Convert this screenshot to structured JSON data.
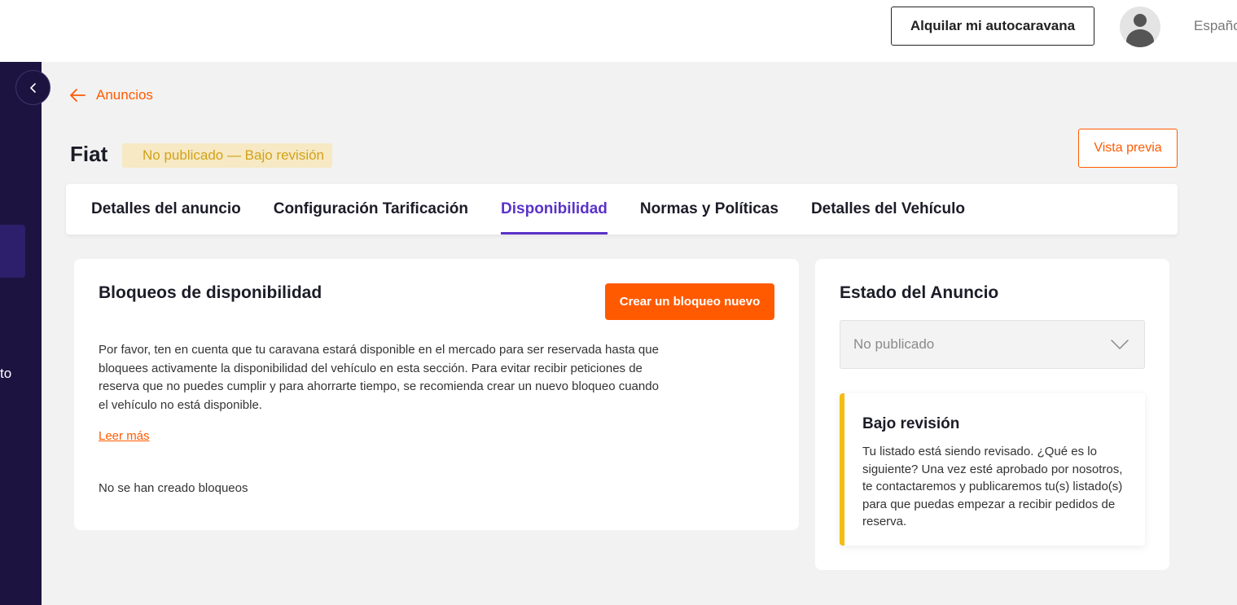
{
  "header": {
    "rent_button": "Alquilar mi autocaravana",
    "language": "Españo"
  },
  "sidebar": {
    "partial_text": "to"
  },
  "back_link": {
    "label": "Anuncios"
  },
  "listing": {
    "title": "Fiat",
    "status_badge": "No publicado — Bajo revisión",
    "preview_button": "Vista previa"
  },
  "tabs": [
    {
      "label": "Detalles del anuncio",
      "active": false
    },
    {
      "label": "Configuración Tarificación",
      "active": false
    },
    {
      "label": "Disponibilidad",
      "active": true
    },
    {
      "label": "Normas y Políticas",
      "active": false
    },
    {
      "label": "Detalles del Vehículo",
      "active": false
    }
  ],
  "availability": {
    "title": "Bloqueos de disponibilidad",
    "create_button": "Crear un bloqueo nuevo",
    "description": "Por favor, ten en cuenta que tu caravana estará disponible en el mercado para ser reservada hasta que bloquees activamente la disponibilidad del vehículo en esta sección. Para evitar recibir peticiones de reserva que no puedes cumplir y para ahorrarte tiempo, se recomienda crear un nuevo bloqueo cuando el vehículo no está disponible.",
    "read_more": "Leer más",
    "empty_text": "No se han creado bloqueos"
  },
  "listing_status": {
    "title": "Estado del Anuncio",
    "selected": "No publicado",
    "review_title": "Bajo revisión",
    "review_text": "Tu listado está siendo revisado. ¿Qué es lo siguiente? Una vez esté aprobado por nosotros, te contactaremos y publicaremos tu(s) listado(s) para que puedas empezar a recibir pedidos de reserva."
  },
  "colors": {
    "accent": "#ff5a00",
    "tab_active": "#5a32c8",
    "sidebar": "#1d1340",
    "badge_bg": "#f6e9c4",
    "badge_text": "#d3a21a",
    "review_border": "#f5bd10"
  }
}
